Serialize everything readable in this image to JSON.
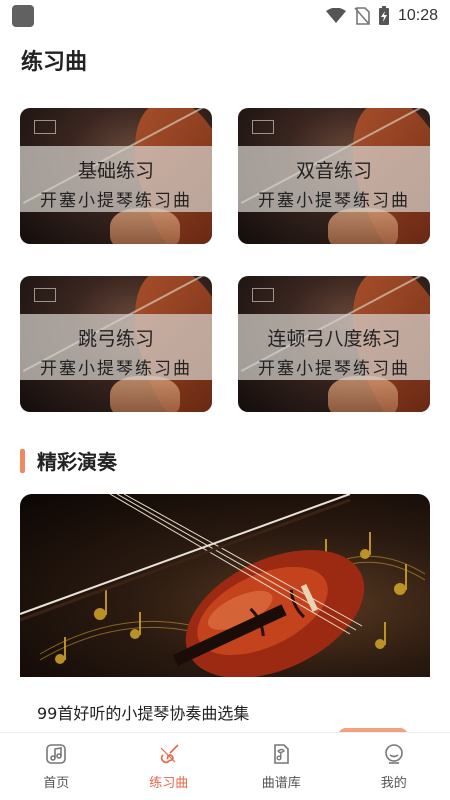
{
  "status_bar": {
    "time": "10:28"
  },
  "header": {
    "title": "练习曲"
  },
  "cards": [
    {
      "title": "基础练习",
      "subtitle": "开塞小提琴练习曲"
    },
    {
      "title": "双音练习",
      "subtitle": "开塞小提琴练习曲"
    },
    {
      "title": "跳弓练习",
      "subtitle": "开塞小提琴练习曲"
    },
    {
      "title": "连顿弓八度练习",
      "subtitle": "开塞小提琴练习曲"
    }
  ],
  "section": {
    "title": "精彩演奏"
  },
  "featured": {
    "caption": "99首好听的小提琴协奏曲选集"
  },
  "nav": {
    "items": [
      {
        "label": "首页",
        "icon": "music-note-icon"
      },
      {
        "label": "练习曲",
        "icon": "violin-icon"
      },
      {
        "label": "曲谱库",
        "icon": "score-icon"
      },
      {
        "label": "我的",
        "icon": "profile-icon"
      }
    ],
    "active_index": 1,
    "active_color": "#e8664a",
    "inactive_color": "#555555"
  },
  "colors": {
    "accent": "#f08860",
    "pill": "#f3a07d"
  }
}
